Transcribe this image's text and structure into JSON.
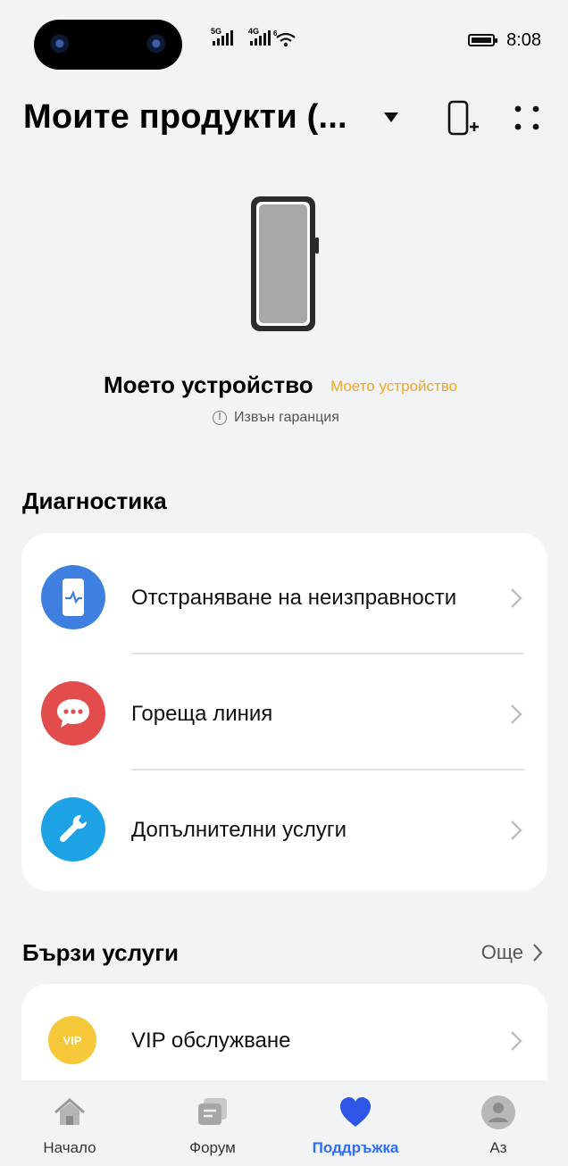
{
  "status_bar": {
    "time": "8:08",
    "network1": "5G",
    "network2": "4G",
    "wifi_tag": "6"
  },
  "header": {
    "title": "Моите продукти (...",
    "icons": [
      "add-device-icon",
      "more-icon"
    ]
  },
  "device": {
    "name": "Моето устройство",
    "subtitle": "Моето устройство",
    "warranty": "Извън гаранция",
    "accent_color": "#f5a623"
  },
  "diagnostics": {
    "title": "Диагностика",
    "items": [
      {
        "label": "Отстраняване на неизправности",
        "icon": "phone-diagnostic-icon",
        "color": "#3f7fe0"
      },
      {
        "label": "Гореща линия",
        "icon": "chat-bubble-icon",
        "color": "#e34c4c"
      },
      {
        "label": "Допълнителни услуги",
        "icon": "wrench-icon",
        "color": "#1ea2e6"
      }
    ]
  },
  "quick_services": {
    "title": "Бързи услуги",
    "more_label": "Още",
    "items": [
      {
        "label": "VIP обслужване",
        "icon": "vip-icon",
        "icon_text": "VIP",
        "color": "#f5c83a"
      }
    ]
  },
  "bottom_nav": {
    "items": [
      {
        "label": "Начало",
        "icon": "home-icon"
      },
      {
        "label": "Форум",
        "icon": "forum-icon"
      },
      {
        "label": "Поддръжка",
        "icon": "heart-icon",
        "active": true
      },
      {
        "label": "Аз",
        "icon": "profile-icon"
      }
    ],
    "active_color": "#2e6cf6"
  }
}
